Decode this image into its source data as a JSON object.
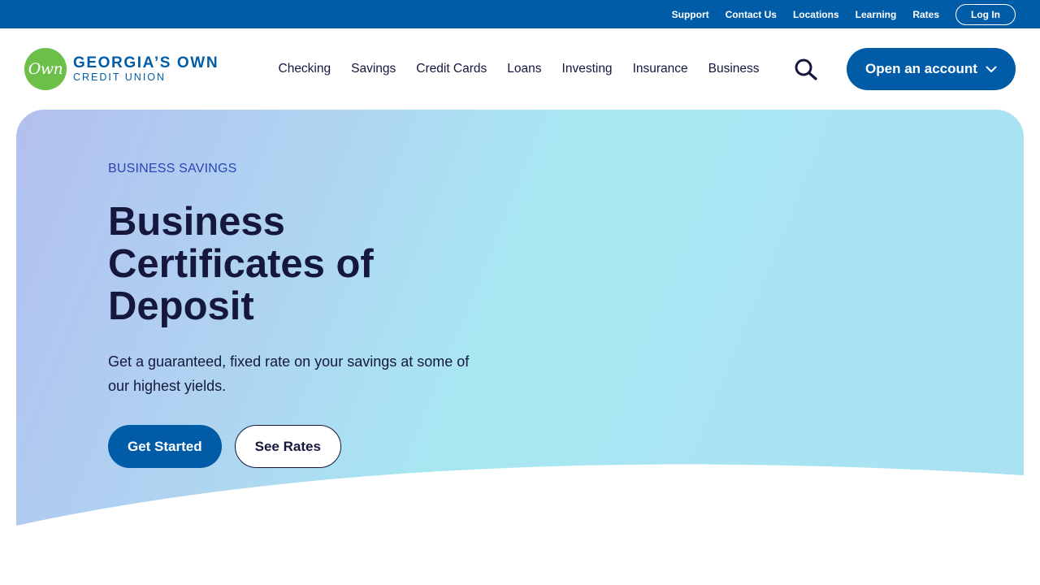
{
  "utility_nav": {
    "links": [
      "Support",
      "Contact Us",
      "Locations",
      "Learning",
      "Rates"
    ],
    "login_label": "Log In"
  },
  "logo": {
    "mark": "Own",
    "line1": "GEORGIA’S OWN",
    "line2": "CREDIT UNION"
  },
  "primary_nav": {
    "items": [
      "Checking",
      "Savings",
      "Credit Cards",
      "Loans",
      "Investing",
      "Insurance",
      "Business"
    ],
    "search_icon": "search-icon",
    "cta_label": "Open an account",
    "cta_icon": "chevron-down-icon"
  },
  "hero": {
    "eyebrow": "BUSINESS SAVINGS",
    "title": "Business Certificates of Deposit",
    "description": "Get a guaranteed, fixed rate on your savings at some of our highest yields.",
    "primary_button": "Get Started",
    "secondary_button": "See Rates"
  },
  "colors": {
    "brand_blue": "#005ca7",
    "brand_green": "#6cc04a",
    "text_dark": "#15173d",
    "eyebrow_blue": "#2a45b8"
  }
}
